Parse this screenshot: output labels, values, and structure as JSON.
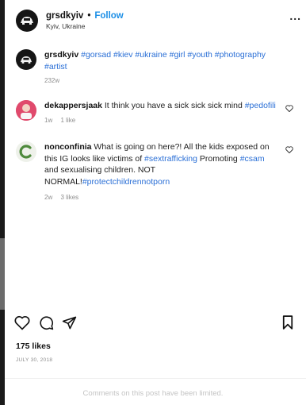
{
  "post": {
    "username": "grsdkyiv",
    "separator": "•",
    "follow_label": "Follow",
    "location": "Kyiv, Ukraine",
    "more_label": "..."
  },
  "caption": {
    "username": "grsdkyiv",
    "tags_line": "#gorsad #kiev #ukraine #girl #youth #photography #artist",
    "time": "232w"
  },
  "comments": [
    {
      "username": "dekappersjaak",
      "text": "It think you have a sick sick sick mind",
      "tag": "#pedofili",
      "time": "1w",
      "likes": "1 like"
    },
    {
      "username": "nonconfinia",
      "text_a": "What is going on here?! All the kids exposed on this IG looks like victims of",
      "tag_a": "#sextrafficking",
      "text_b": "Promoting",
      "tag_b": "#csam",
      "text_c": "and sexualising children. NOT NORMAL!",
      "tag_c": "#protectchildrennotporn",
      "time": "2w",
      "likes": "3 likes"
    }
  ],
  "footer": {
    "likes": "175 likes",
    "date": "JULY 30, 2018",
    "comments_limited": "Comments on this post have been limited."
  },
  "icons": {
    "heart": "heart-icon",
    "comment": "comment-icon",
    "share": "share-icon",
    "save": "bookmark-icon"
  },
  "colors": {
    "follow": "#1d8fe6",
    "hashtag": "#2a6fd6",
    "meta": "#8e8e8e"
  }
}
